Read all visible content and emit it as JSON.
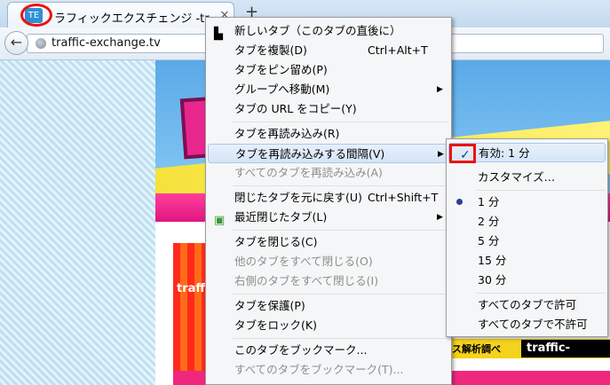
{
  "tab": {
    "title": "ラフィックエクスチェンジ -tr...",
    "close": "×",
    "new_tab": "+",
    "favicon": "TE"
  },
  "nav": {
    "back": "←",
    "url": "traffic-exchange.tv"
  },
  "site": {
    "promo_text": "traff サー",
    "analysis_label": "ス解析調べ",
    "exchange_link": "traffic-exchang"
  },
  "context_menu": {
    "items": [
      {
        "label": "新しいタブ（このタブの直後に）",
        "shortcut": "",
        "icon": "new-tab-icon",
        "disabled": false
      },
      {
        "label": "タブを複製(D)",
        "shortcut": "Ctrl+Alt+T",
        "disabled": false
      },
      {
        "label": "タブをピン留め(P)",
        "shortcut": "",
        "disabled": false
      },
      {
        "label": "グループへ移動(M)",
        "shortcut": "",
        "submenu": true,
        "disabled": false
      },
      {
        "label": "タブの URL をコピー(Y)",
        "shortcut": "",
        "disabled": false
      },
      {
        "label": "タブを再読み込み(R)",
        "shortcut": "",
        "disabled": false
      },
      {
        "label": "タブを再読み込みする間隔(V)",
        "shortcut": "",
        "submenu": true,
        "disabled": false
      },
      {
        "label": "すべてのタブを再読み込み(A)",
        "shortcut": "",
        "disabled": true
      },
      {
        "label": "閉じたタブを元に戻す(U)",
        "shortcut": "Ctrl+Shift+T",
        "disabled": false
      },
      {
        "label": "最近閉じたタブ(L)",
        "shortcut": "",
        "submenu": true,
        "icon": "recent-closed-icon",
        "disabled": false
      },
      {
        "label": "タブを閉じる(C)",
        "shortcut": "",
        "disabled": false
      },
      {
        "label": "他のタブをすべて閉じる(O)",
        "shortcut": "",
        "disabled": true
      },
      {
        "label": "右側のタブをすべて閉じる(I)",
        "shortcut": "",
        "disabled": true
      },
      {
        "label": "タブを保護(P)",
        "shortcut": "",
        "disabled": false
      },
      {
        "label": "タブをロック(K)",
        "shortcut": "",
        "disabled": false
      },
      {
        "label": "このタブをブックマーク...",
        "shortcut": "",
        "disabled": false
      },
      {
        "label": "すべてのタブをブックマーク(T)...",
        "shortcut": "",
        "disabled": true
      }
    ],
    "submenu_arrow": "▶"
  },
  "reload_submenu": {
    "items": [
      {
        "label": "有効: 1 分",
        "checked": true
      },
      {
        "label": "カスタマイズ…"
      },
      {
        "label": "1 分",
        "selected": true
      },
      {
        "label": "2 分"
      },
      {
        "label": "5 分"
      },
      {
        "label": "15 分"
      },
      {
        "label": "30 分"
      },
      {
        "label": "すべてのタブで許可"
      },
      {
        "label": "すべてのタブで不許可"
      }
    ],
    "check_mark": "✓"
  },
  "colors": {
    "highlight_red": "#e11111",
    "menu_bg": "#f5f6f7",
    "hover_blue": "#d5e5f8"
  }
}
